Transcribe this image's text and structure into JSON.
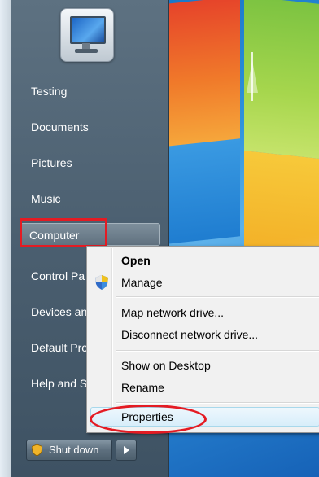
{
  "start_menu": {
    "places": [
      {
        "label": "Testing"
      },
      {
        "label": "Documents"
      },
      {
        "label": "Pictures"
      },
      {
        "label": "Music"
      },
      {
        "label": "Computer"
      },
      {
        "label": "Control Pa"
      },
      {
        "label": "Devices an"
      },
      {
        "label": "Default Pro"
      },
      {
        "label": "Help and S"
      }
    ],
    "shutdown_label": "Shut down"
  },
  "context_menu": {
    "items": [
      {
        "label": "Open"
      },
      {
        "label": "Manage"
      },
      {
        "label": "Map network drive..."
      },
      {
        "label": "Disconnect network drive..."
      },
      {
        "label": "Show on Desktop"
      },
      {
        "label": "Rename"
      },
      {
        "label": "Properties"
      }
    ]
  },
  "colors": {
    "highlight_red": "#e41b23",
    "menu_bg": "#f1f1f1",
    "start_menu_bg": "#4b5f70"
  },
  "icons": [
    "user-picture-icon",
    "uac-shield-icon",
    "arrow-right-icon"
  ]
}
